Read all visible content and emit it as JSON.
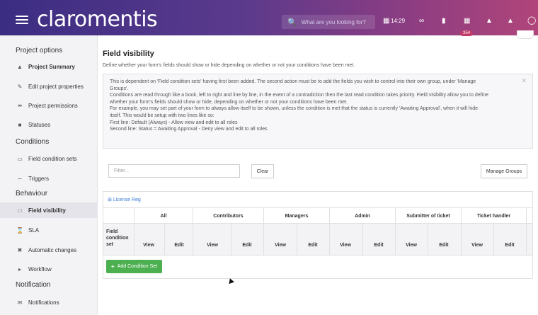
{
  "header": {
    "logo": "claromentis",
    "search_placeholder": "What are you looking for?",
    "time": "14:29",
    "notification_count": "354"
  },
  "sidebar": {
    "sections": [
      {
        "title": "Project options"
      },
      {
        "title": "Conditions"
      },
      {
        "title": "Behaviour"
      },
      {
        "title": "Notification"
      }
    ],
    "items": [
      {
        "label": "Project Summary",
        "icon": "home-icon"
      },
      {
        "label": "Edit project properties",
        "icon": "pencil-icon"
      },
      {
        "label": "Project permissions",
        "icon": "key-icon"
      },
      {
        "label": "Statuses",
        "icon": "folder-icon"
      },
      {
        "label": "Field condition sets",
        "icon": "rectangle-icon"
      },
      {
        "label": "Triggers",
        "icon": "triggers-icon"
      },
      {
        "label": "Field visibility",
        "icon": "visibility-icon"
      },
      {
        "label": "SLA",
        "icon": "hourglass-icon"
      },
      {
        "label": "Automatic changes",
        "icon": "automation-icon"
      },
      {
        "label": "Workflow",
        "icon": "workflow-icon"
      },
      {
        "label": "Notifications",
        "icon": "envelope-icon"
      }
    ]
  },
  "main": {
    "title": "Field visibility",
    "subtitle": "Define whether your form's fields should show or hide depending on whether or not your conditions have been met.",
    "info_lines": [
      "This is dependent on 'Field condition sets' having first been added. The second action must be to add the fields you wish to control into their own group, under 'Manage",
      "Groups'.",
      "Conditions are read through like a book, left to right and line by line, in the event of a contradiction then the last read condition takes priority. Field visibility allow you to define",
      "whether your form's fields should show or hide, depending on whether or not your conditions have been met.",
      "For example, you may set part of your form to always allow itself to be shown, unless the condition is met that the status is currently 'Awaiting Approval', when it will hide",
      "itself. This would be setup with two lines like so:",
      "First line: Default (Always) - Allow view and edit to all roles",
      "Second line: Status = Awaiting Approval - Deny view and edit to all roles"
    ],
    "filter_placeholder": "Filter...",
    "clear_label": "Clear",
    "manage_groups_label": "Manage Groups",
    "table": {
      "group_label": "License Reg",
      "row_label_line1": "Field",
      "row_label_line2": "condition",
      "row_label_line3": "set",
      "roles": [
        "All",
        "Contributors",
        "Managers",
        "Admin",
        "Submitter of ticket",
        "Ticket handler"
      ],
      "view_label": "View",
      "edit_label": "Edit",
      "add_label": "Add Condition Set"
    }
  },
  "colors": {
    "header_gradient_start": "#3b2d82",
    "header_gradient_end": "#b0457a",
    "add_button": "#4caf50",
    "link": "#3a7bd5"
  }
}
